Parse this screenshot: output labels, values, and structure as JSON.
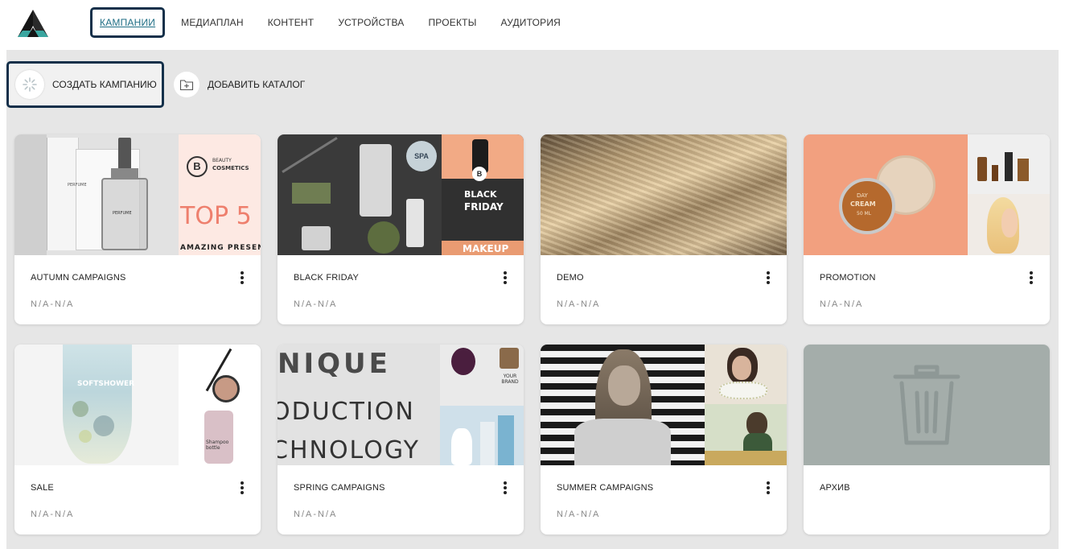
{
  "nav": {
    "items": [
      "КАМПАНИИ",
      "МЕДИАПЛАН",
      "КОНТЕНТ",
      "УСТРОЙСТВА",
      "ПРОЕКТЫ",
      "АУДИТОРИЯ"
    ],
    "active_index": 0
  },
  "actions": {
    "create_label": "СОЗДАТЬ КАМПАНИЮ",
    "catalog_label": "ДОБАВИТЬ КАТАЛОГ"
  },
  "cards": [
    {
      "title": "AUTUMN CAMPAIGNS",
      "meta": "N/A-N/A",
      "image_text": {
        "brand_letter": "B",
        "brand_line1": "BEAUTY",
        "brand_line2": "COSMETICS",
        "headline": "TOP 5",
        "subline": "AMAZING PRESENT",
        "perfume": "PERFUME"
      }
    },
    {
      "title": "BLACK FRIDAY",
      "meta": "N/A-N/A",
      "image_text": {
        "badge": "B",
        "line1": "BLACK",
        "line2": "FRIDAY",
        "line3": "MAKEUP",
        "spa": "SPA"
      }
    },
    {
      "title": "DEMO",
      "meta": "N/A-N/A",
      "image_text": {}
    },
    {
      "title": "PROMOTION",
      "meta": "N/A-N/A",
      "image_text": {
        "jar_line1": "DAY",
        "jar_line2": "CREAM",
        "jar_line3": "50 ML"
      }
    },
    {
      "title": "SALE",
      "meta": "N/A-N/A",
      "image_text": {
        "tube": "SOFTSHOWER",
        "bottle": "Shampoo bottle"
      }
    },
    {
      "title": "SPRING CAMPAIGNS",
      "meta": "N/A-N/A",
      "image_text": {
        "line1": "NIQUE",
        "line2": "ODUCTION",
        "line3": "CHNOLOGY",
        "brand": "YOUR BRAND"
      }
    },
    {
      "title": "SUMMER CAMPAIGNS",
      "meta": "N/A-N/A",
      "image_text": {}
    },
    {
      "title": "АРХИВ",
      "meta": "",
      "image_text": {}
    }
  ],
  "colors": {
    "accent": "#1f6e85",
    "focus_border": "#14304a",
    "workspace_bg": "#e6e6e6",
    "archive_bg": "#a4adaa",
    "promo_orange": "#f2a07f"
  }
}
